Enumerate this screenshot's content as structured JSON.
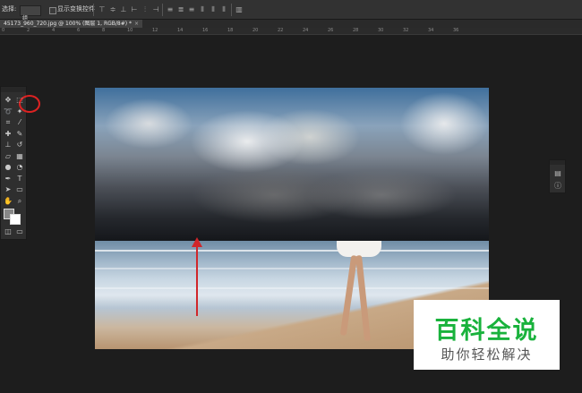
{
  "options_bar": {
    "select_label": "选择:",
    "select_value": "组",
    "show_transform_label": "显示变换控件"
  },
  "document_tab": {
    "title": "45173_960_720.jpg @ 100% (图层 1, RGB/8#) *",
    "close": "×"
  },
  "ruler": {
    "ticks": [
      "0",
      "2",
      "4",
      "6",
      "8",
      "10",
      "12",
      "14",
      "16",
      "18",
      "20",
      "22",
      "24",
      "26",
      "28",
      "30",
      "32",
      "34",
      "36"
    ]
  },
  "toolbar": {
    "tools": [
      "move-icon",
      "marquee-icon",
      "lasso-icon",
      "magic-wand-icon",
      "crop-icon",
      "eyedropper-icon",
      "healing-icon",
      "brush-icon",
      "stamp-icon",
      "history-brush-icon",
      "eraser-icon",
      "gradient-icon",
      "blur-icon",
      "dodge-icon",
      "pen-icon",
      "type-icon",
      "path-select-icon",
      "shape-icon",
      "hand-icon",
      "zoom-icon"
    ]
  },
  "watermark": {
    "main": "百科全说",
    "sub": "助你轻松解决",
    "color": "#19b23c"
  },
  "annotation": {
    "circle_color": "#dd2222",
    "arrow_color": "#d0262a"
  }
}
